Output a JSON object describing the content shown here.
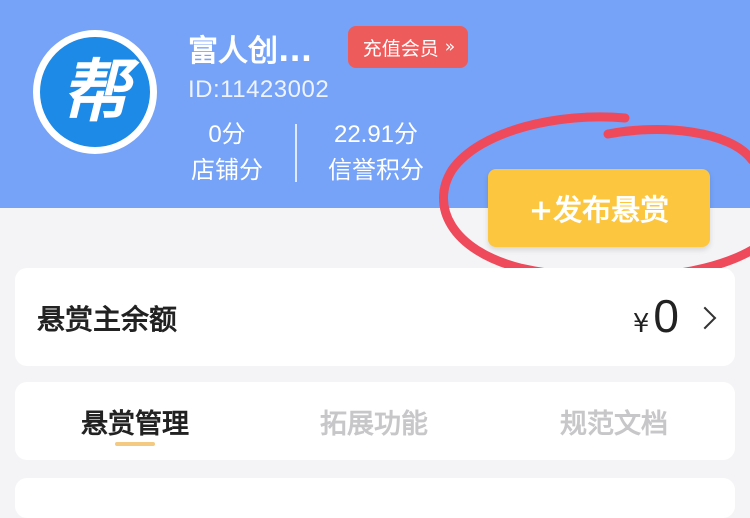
{
  "header": {
    "avatar_glyph": "帮",
    "username": "富人创...",
    "vip_button": {
      "label": "充值会员",
      "chevron": "»"
    },
    "user_id": "ID:11423002",
    "stats": [
      {
        "value": "0分",
        "label": "店铺分"
      },
      {
        "value": "22.91分",
        "label": "信誉积分"
      }
    ],
    "publish_button": "+发布悬赏"
  },
  "balance": {
    "label": "悬赏主余额",
    "currency": "¥",
    "amount": "0"
  },
  "tabs": [
    {
      "label": "悬赏管理",
      "active": true
    },
    {
      "label": "拓展功能",
      "active": false
    },
    {
      "label": "规范文档",
      "active": false
    }
  ],
  "colors": {
    "header_bg": "#76a3f7",
    "publish_button": "#fcc63e",
    "vip_button": "#ee5b5b",
    "annotation_circle": "#ee4a5c",
    "tab_active_underline": "#f4c982"
  }
}
